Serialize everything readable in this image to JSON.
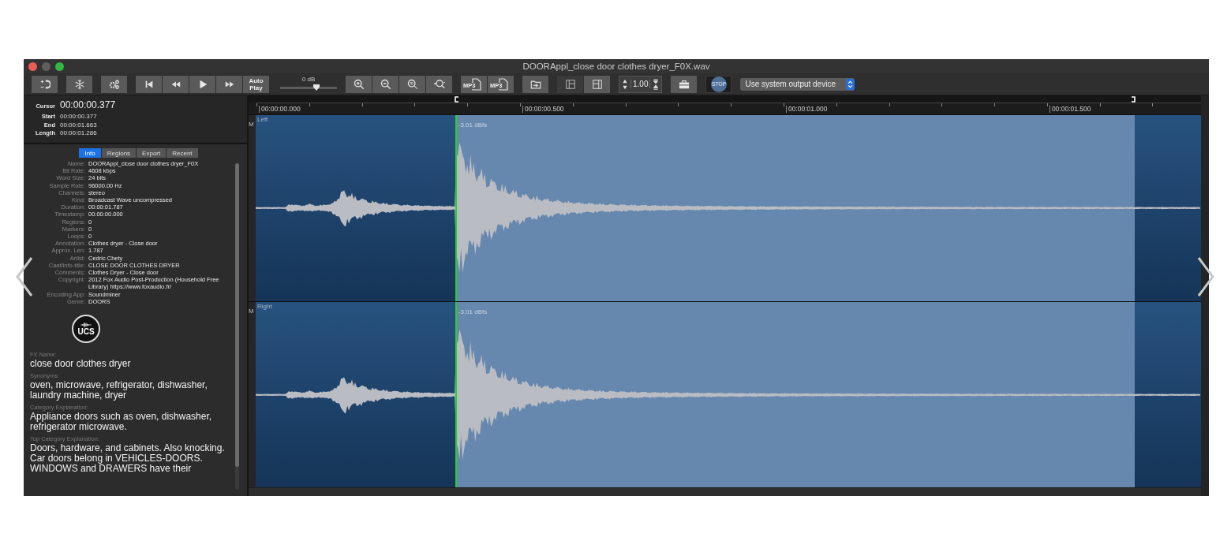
{
  "window": {
    "title": "DOORAppl_close door clothes dryer_F0X.wav"
  },
  "toolbar": {
    "auto_play": "Auto Play",
    "volume": {
      "label": "0 dB",
      "level": 0.64
    },
    "export_buttons": [
      {
        "label": "MP3"
      },
      {
        "label": "MP3"
      }
    ],
    "speed": "1.00",
    "stop": "STOP",
    "output_device": "Use system output device"
  },
  "selection": {
    "cursor": {
      "label": "Cursor",
      "value": "00:00:00.377"
    },
    "rows": [
      {
        "label": "Start",
        "value": "00:00:00.377"
      },
      {
        "label": "End",
        "value": "00:00:01.663"
      },
      {
        "label": "Length",
        "value": "00:00:01.286"
      }
    ]
  },
  "tabs": [
    {
      "label": "Info",
      "selected": true
    },
    {
      "label": "Regions",
      "selected": false
    },
    {
      "label": "Export",
      "selected": false
    },
    {
      "label": "Recent",
      "selected": false
    }
  ],
  "info": [
    {
      "label": "Name:",
      "value": "DOORAppl_close door clothes dryer_F0X"
    },
    {
      "label": "Bit Rate:",
      "value": "4608 kbps"
    },
    {
      "label": "Word Size:",
      "value": "24 bits"
    },
    {
      "label": "Sample Rate:",
      "value": "96000.00 Hz"
    },
    {
      "label": "Channels:",
      "value": "stereo"
    },
    {
      "label": "Kind:",
      "value": "Broadcast Wave uncompressed"
    },
    {
      "label": "Duration:",
      "value": "00:00:01.787"
    },
    {
      "label": "Timestamp:",
      "value": "00:00:00.000"
    },
    {
      "label": "Regions:",
      "value": "0"
    },
    {
      "label": "Markers:",
      "value": "0"
    },
    {
      "label": "Loops:",
      "value": "0"
    },
    {
      "label": "Annotation:",
      "value": "Clothes dryer - Close door"
    },
    {
      "label": "Approx. Len:",
      "value": "1.787"
    },
    {
      "label": "Artist:",
      "value": "Cedric Chety"
    },
    {
      "label": "Caaf/info-title:",
      "value": "CLOSE DOOR CLOTHES DRYER"
    },
    {
      "label": "Comments:",
      "value": "Clothes Dryer - Close door"
    },
    {
      "label": "Copyright:",
      "value": "2012 Fox Audio Post-Production (Household Free Library) https://www.foxaudio.fr/"
    },
    {
      "label": "Encoding App:",
      "value": "Soundminer"
    },
    {
      "label": "Genre:",
      "value": "DOORS"
    }
  ],
  "logo": "UCS",
  "descriptions": [
    {
      "label": "FX Name:",
      "text": "close door clothes dryer"
    },
    {
      "label": "Synonyms:",
      "text": "oven, microwave, refrigerator, dishwasher, laundry machine, dryer"
    },
    {
      "label": "Category Explanation:",
      "text": "Appliance doors such as oven, dishwasher, refrigerator microwave."
    },
    {
      "label": "Top Category Explanation:",
      "text": "Doors, hardware, and cabinets. Also knocking. Car doors belong in VEHICLES-DOORS. WINDOWS and DRAWERS have their"
    }
  ],
  "ruler": [
    "00:00:00.000",
    "00:00:00.500",
    "00:00:01.000",
    "00:00:01.500"
  ],
  "channels": [
    {
      "button": "M",
      "name": "Left",
      "peak": "-3.01 dBfs"
    },
    {
      "button": "M",
      "name": "Right",
      "peak": "-3.01 dBfs"
    }
  ]
}
